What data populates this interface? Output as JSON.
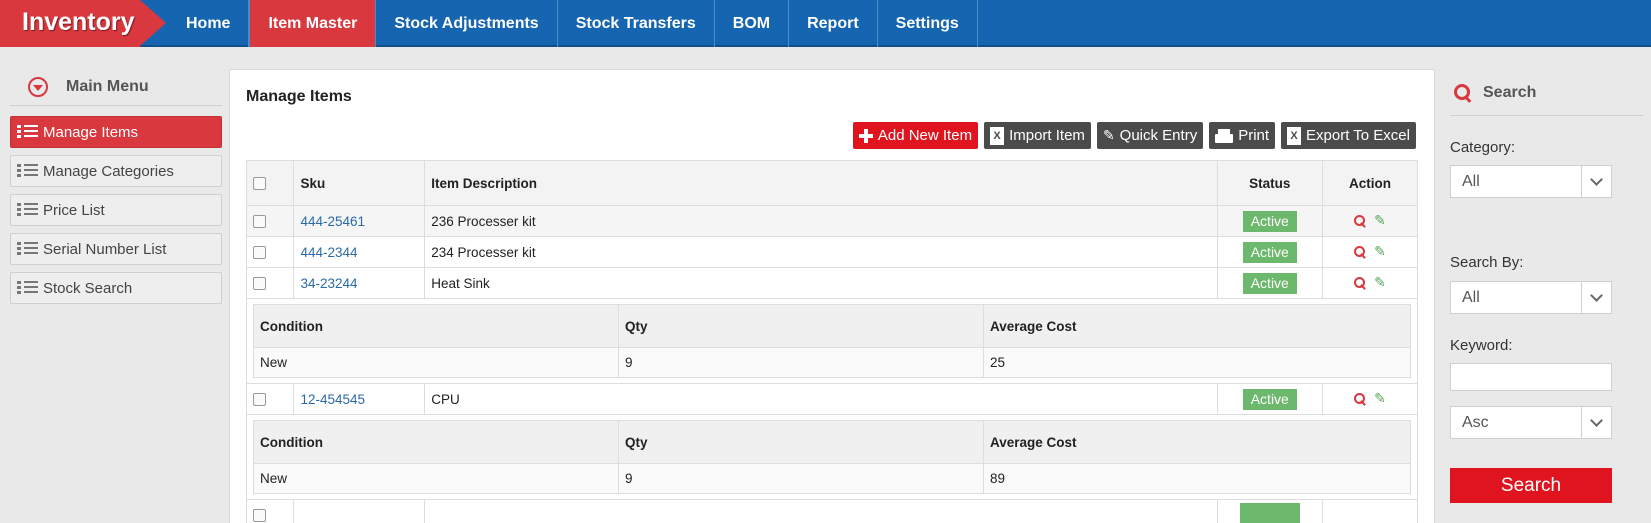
{
  "app": {
    "brand": "Inventory"
  },
  "nav": [
    {
      "label": "Home"
    },
    {
      "label": "Item Master"
    },
    {
      "label": "Stock Adjustments"
    },
    {
      "label": "Stock Transfers"
    },
    {
      "label": "BOM"
    },
    {
      "label": "Report"
    },
    {
      "label": "Settings"
    }
  ],
  "sidebar": {
    "title": "Main Menu",
    "items": [
      {
        "label": "Manage Items"
      },
      {
        "label": "Manage Categories"
      },
      {
        "label": "Price List"
      },
      {
        "label": "Serial Number List"
      },
      {
        "label": "Stock Search"
      }
    ]
  },
  "main": {
    "title": "Manage Items",
    "toolbar": {
      "add": "Add New Item",
      "import": "Import Item",
      "quick": "Quick Entry",
      "print": "Print",
      "export": "Export To Excel"
    },
    "columns": {
      "sku": "Sku",
      "desc": "Item Description",
      "status": "Status",
      "action": "Action"
    },
    "rows": [
      {
        "sku": "444-25461",
        "desc": "236 Processer kit",
        "status": "Active"
      },
      {
        "sku": "444-2344",
        "desc": "234 Processer kit",
        "status": "Active"
      },
      {
        "sku": "34-23244",
        "desc": "Heat Sink",
        "status": "Active"
      },
      {
        "sku": "12-454545",
        "desc": "CPU",
        "status": "Active"
      }
    ],
    "sub_columns": {
      "condition": "Condition",
      "qty": "Qty",
      "cost": "Average Cost"
    },
    "sub_rows": [
      {
        "condition": "New",
        "qty": "9",
        "cost": "25"
      },
      {
        "condition": "New",
        "qty": "9",
        "cost": "89"
      }
    ]
  },
  "search": {
    "title": "Search",
    "category_label": "Category:",
    "category_value": "All",
    "search_by_label": "Search By:",
    "search_by_value": "All",
    "keyword_label": "Keyword:",
    "keyword_value": "",
    "order_value": "Asc",
    "button": "Search"
  },
  "colors": {
    "brand_red": "#d9383f",
    "nav_blue": "#1565b0",
    "active_green": "#6cb86c",
    "button_red": "#e0141e"
  },
  "icons": [
    "chevron-down-icon",
    "list-icon",
    "plus-icon",
    "excel-icon",
    "pencil-icon",
    "printer-icon",
    "magnifier-icon",
    "edit-icon",
    "search-icon"
  ]
}
